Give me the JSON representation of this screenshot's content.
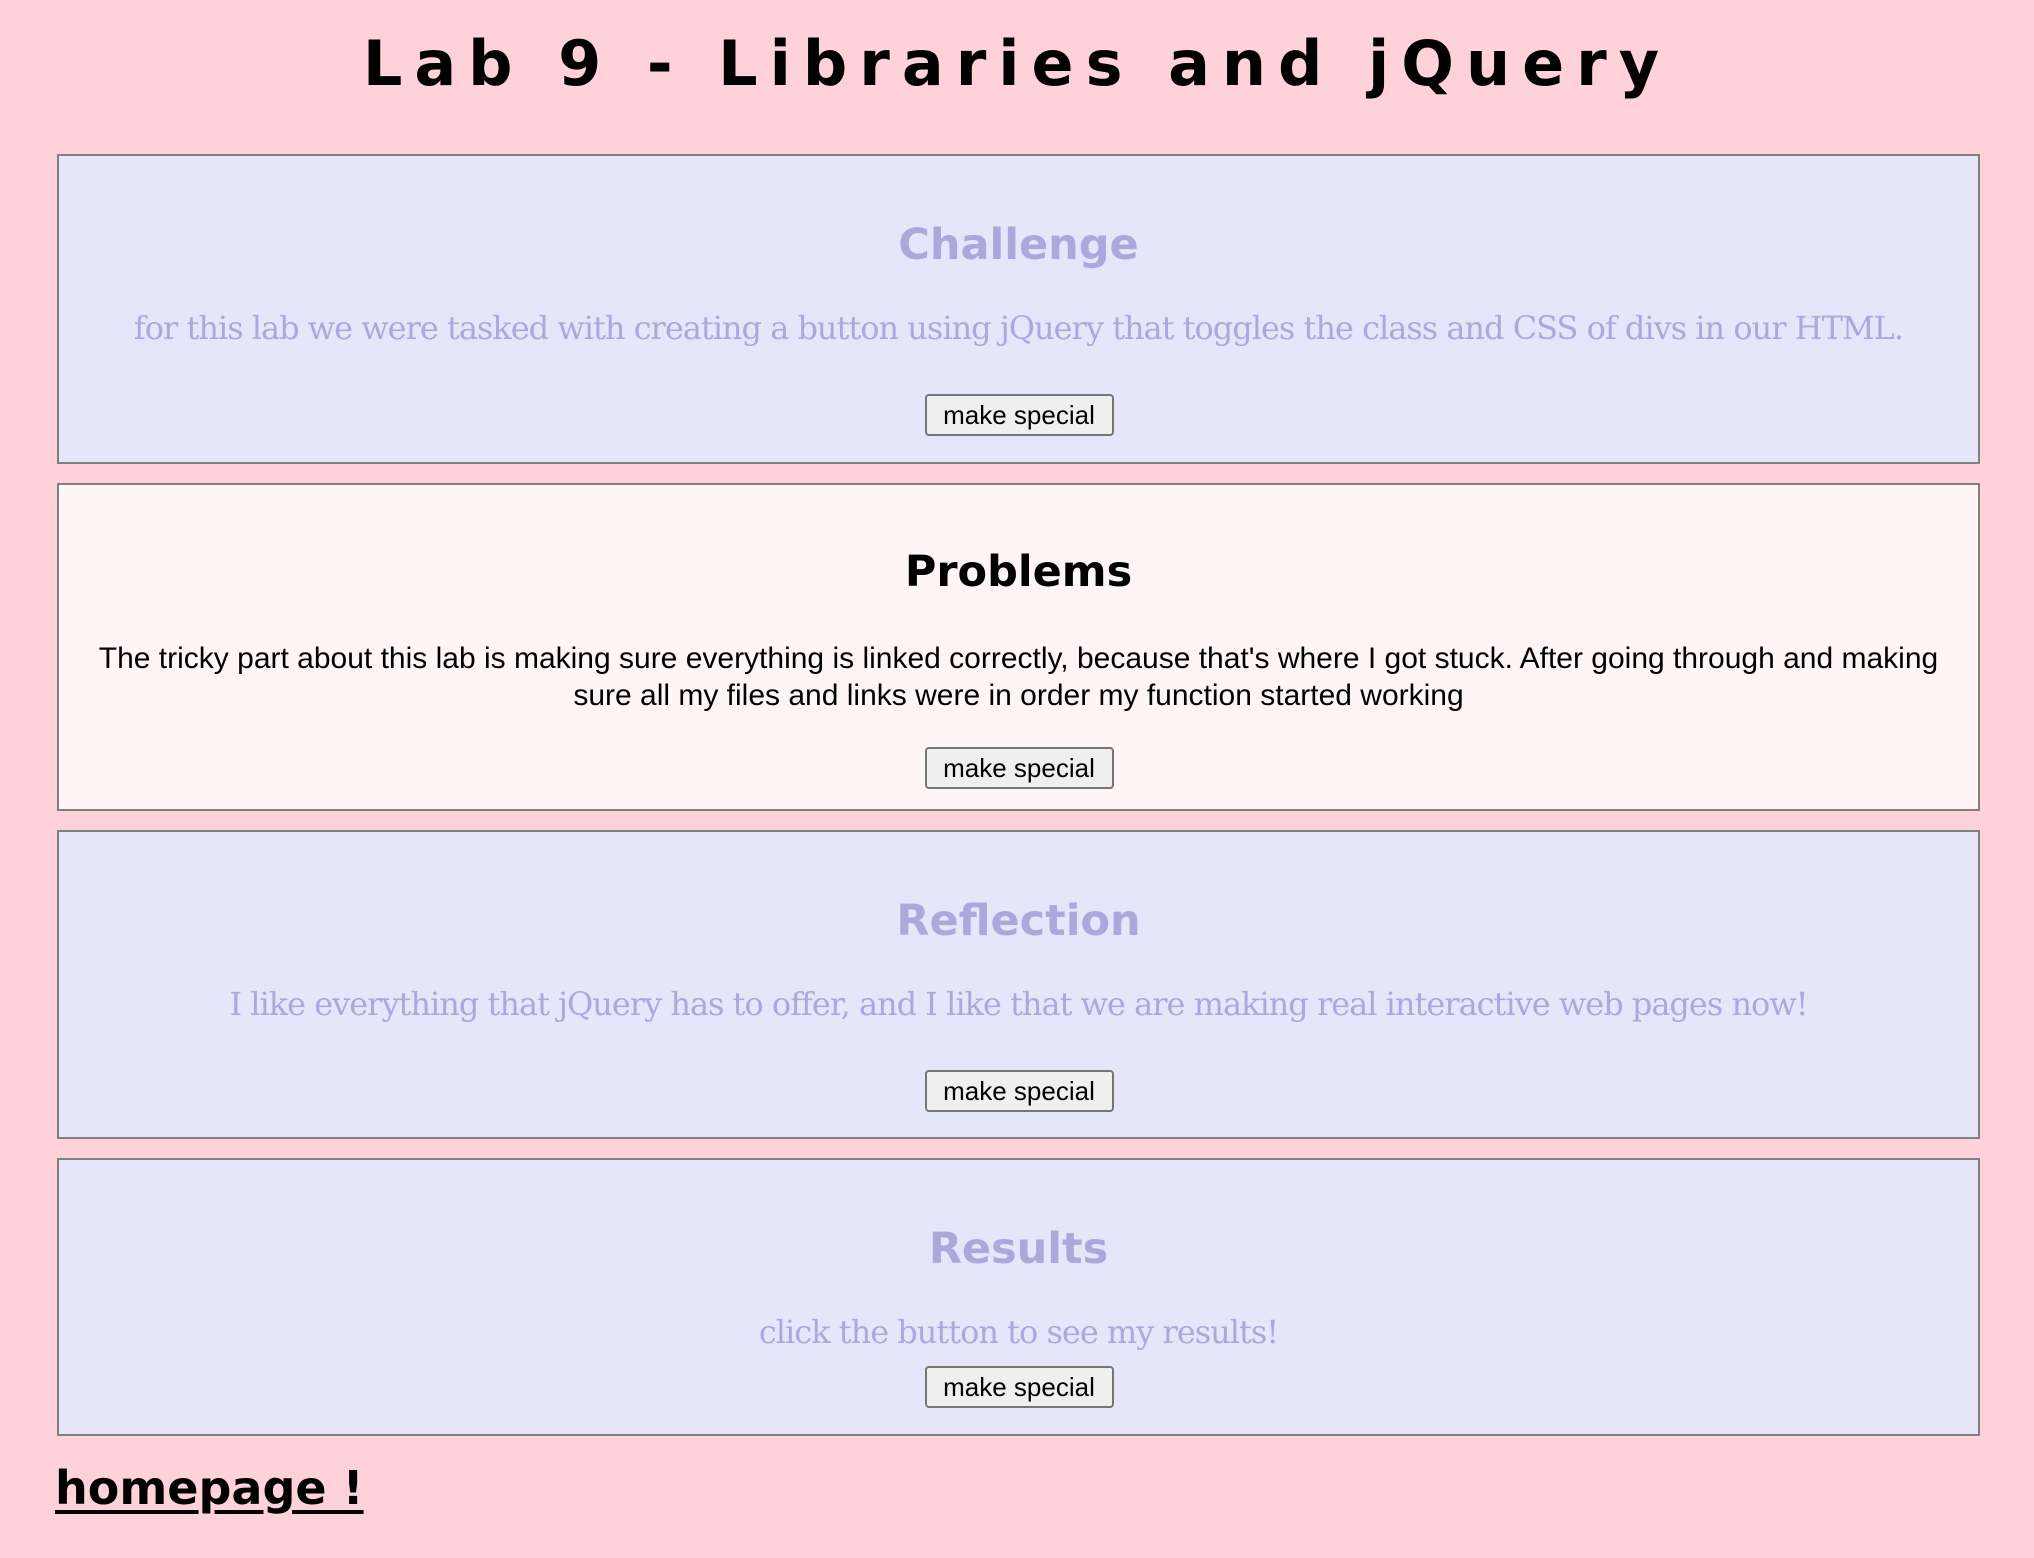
{
  "page": {
    "title": "Lab 9 - Libraries and jQuery"
  },
  "sections": [
    {
      "heading": "Challenge",
      "text": "for this lab we were tasked with creating a button using jQuery that toggles the class and CSS of divs in our HTML.",
      "button_label": "make special"
    },
    {
      "heading": "Problems",
      "text": "The tricky part about this lab is making sure everything is linked correctly, because that's where I got stuck. After going through and making sure all my files and links were in order my function started working",
      "button_label": "make special"
    },
    {
      "heading": "Reflection",
      "text": "I like everything that jQuery has to offer, and I like that we are making real interactive web pages now!",
      "button_label": "make special"
    },
    {
      "heading": "Results",
      "text": "click the button to see my results!",
      "button_label": "make special"
    }
  ],
  "footer": {
    "homepage_link": "homepage !"
  },
  "colors": {
    "page_background": "#ffd1d8",
    "section_background": "#e6e6fa",
    "section_text": "#a9a9dc",
    "special_background": "#fff4f6",
    "special_text": "#000000"
  }
}
